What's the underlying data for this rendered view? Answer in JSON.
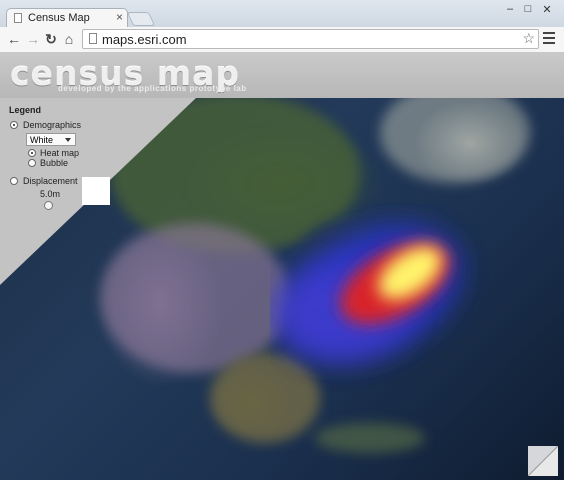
{
  "browser": {
    "tab_title": "Census Map",
    "tab_close": "×",
    "url": "maps.esri.com",
    "controls": {
      "minimize": "–",
      "maximize": "□",
      "close": "✕"
    },
    "nav": {
      "back": "←",
      "forward": "→",
      "reload": "↻",
      "home": "⌂"
    },
    "star": "☆"
  },
  "app": {
    "logo": "census map",
    "subtitle": "developed by the applications prototype lab",
    "legend": {
      "title": "Legend",
      "demographics_label": "Demographics",
      "selected_group": "White",
      "heat_map_label": "Heat map",
      "bubble_label": "Bubble",
      "displacement_label": "Displacement",
      "displacement_value": "5.0m"
    }
  },
  "colors": {
    "heat_core": "#fff36a",
    "heat_mid": "#e02424",
    "heat_outer": "#2a35d8"
  }
}
